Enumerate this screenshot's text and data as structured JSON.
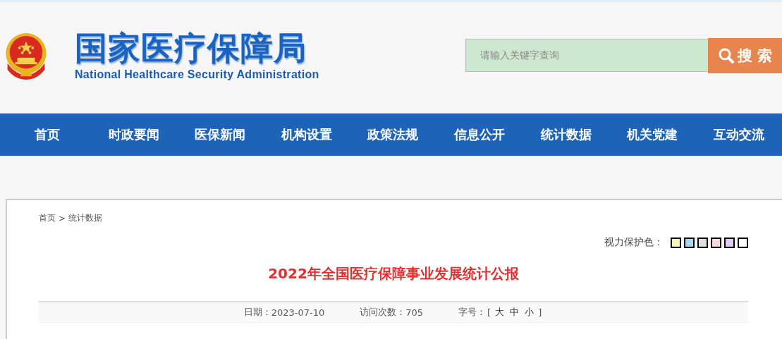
{
  "header": {
    "title": "国家医疗保障局",
    "subtitle": "National Healthcare Security Administration"
  },
  "search": {
    "placeholder": "请输入关键字查询",
    "button": "搜 索"
  },
  "nav": [
    {
      "label": "首页"
    },
    {
      "label": "时政要闻"
    },
    {
      "label": "医保新闻"
    },
    {
      "label": "机构设置"
    },
    {
      "label": "政策法规"
    },
    {
      "label": "信息公开"
    },
    {
      "label": "统计数据"
    },
    {
      "label": "机关党建"
    },
    {
      "label": "互动交流"
    }
  ],
  "breadcrumb": [
    {
      "label": "首页"
    },
    {
      "label": "统计数据"
    }
  ],
  "breadcrumb_separator": ">",
  "eye_care": {
    "label": "视力保护色：",
    "swatches": [
      {
        "color": "#faf8b4"
      },
      {
        "color": "#a5d8f3"
      },
      {
        "color": "#dfdfdf"
      },
      {
        "color": "#f9d8de"
      },
      {
        "color": "#e2cbf5"
      },
      {
        "color": "#ffffff"
      }
    ]
  },
  "article": {
    "title": "2022年全国医疗保障事业发展统计公报",
    "date_label": "日期：",
    "date": "2023-07-10",
    "visits_label": "访问次数：",
    "visits": "705",
    "font_size_label": "字号：",
    "font_size_open": "[",
    "font_sizes": [
      "大",
      "中",
      "小"
    ],
    "font_size_close": "]"
  }
}
